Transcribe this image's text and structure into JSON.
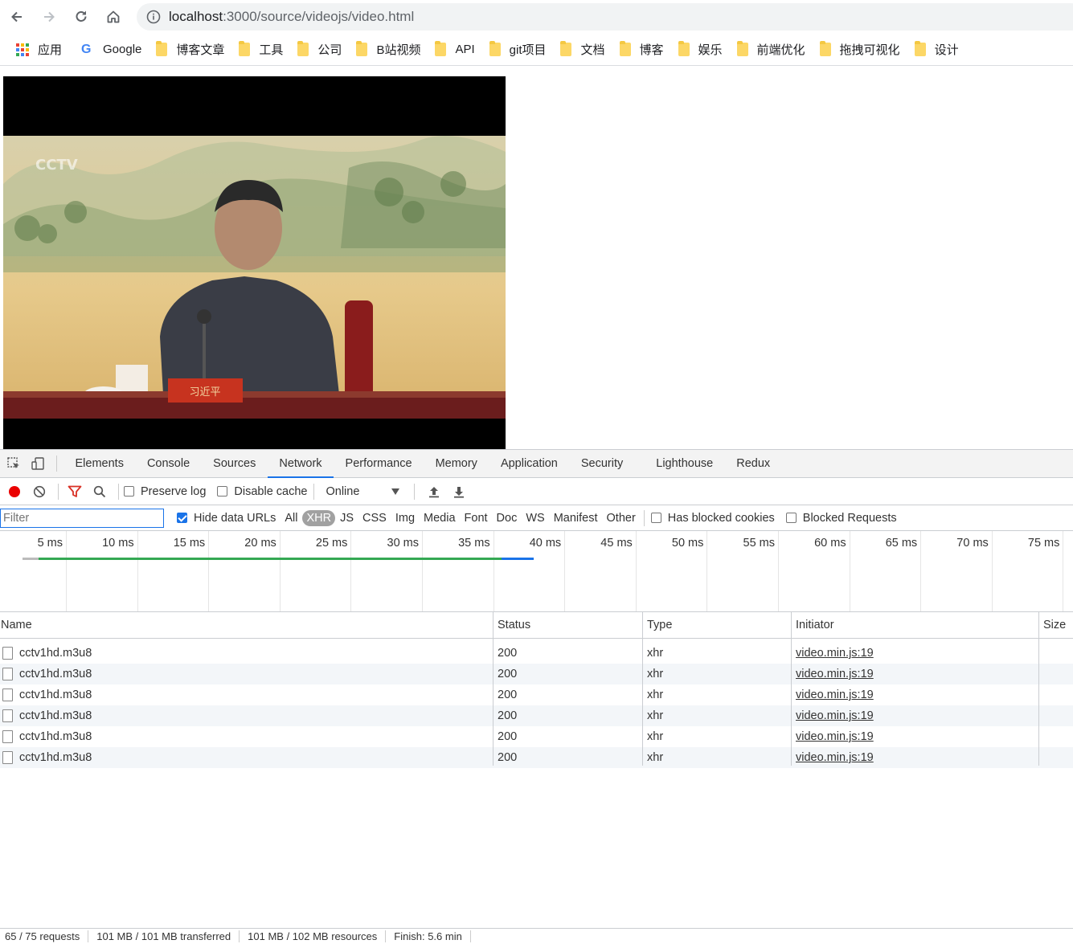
{
  "browser": {
    "url_host": "localhost",
    "url_rest": ":3000/source/videojs/video.html",
    "bookmarks": [
      {
        "label": "应用",
        "icon": "apps-grid-icon"
      },
      {
        "label": "Google",
        "icon": "google-icon"
      },
      {
        "label": "博客文章",
        "icon": "folder-icon"
      },
      {
        "label": "工具",
        "icon": "folder-icon"
      },
      {
        "label": "公司",
        "icon": "folder-icon"
      },
      {
        "label": "B站视频",
        "icon": "folder-icon"
      },
      {
        "label": "API",
        "icon": "folder-icon"
      },
      {
        "label": "git项目",
        "icon": "folder-icon"
      },
      {
        "label": "文档",
        "icon": "folder-icon"
      },
      {
        "label": "博客",
        "icon": "folder-icon"
      },
      {
        "label": "娱乐",
        "icon": "folder-icon"
      },
      {
        "label": "前端优化",
        "icon": "folder-icon"
      },
      {
        "label": "拖拽可视化",
        "icon": "folder-icon"
      },
      {
        "label": "设计",
        "icon": "folder-icon"
      }
    ]
  },
  "video": {
    "nameplate": "习近平"
  },
  "devtools": {
    "tabs": [
      "Elements",
      "Console",
      "Sources",
      "Network",
      "Performance",
      "Memory",
      "Application",
      "Security",
      "Lighthouse",
      "Redux"
    ],
    "active_tab": "Network",
    "controls": {
      "preserve_log": "Preserve log",
      "disable_cache": "Disable cache",
      "throttling": "Online"
    },
    "filter": {
      "placeholder": "Filter",
      "hide_data_urls": "Hide data URLs",
      "types": [
        "All",
        "XHR",
        "JS",
        "CSS",
        "Img",
        "Media",
        "Font",
        "Doc",
        "WS",
        "Manifest",
        "Other"
      ],
      "active_type": "XHR",
      "has_blocked_cookies": "Has blocked cookies",
      "blocked_requests": "Blocked Requests"
    },
    "timeline_ticks": [
      "5 ms",
      "10 ms",
      "15 ms",
      "20 ms",
      "25 ms",
      "30 ms",
      "35 ms",
      "40 ms",
      "45 ms",
      "50 ms",
      "55 ms",
      "60 ms",
      "65 ms",
      "70 ms",
      "75 ms"
    ],
    "columns": [
      "Name",
      "Status",
      "Type",
      "Initiator",
      "Size"
    ],
    "rows": [
      {
        "name": "cctv1hd.m3u8",
        "status": "200",
        "type": "xhr",
        "initiator": "video.min.js:19"
      },
      {
        "name": "cctv1hd.m3u8",
        "status": "200",
        "type": "xhr",
        "initiator": "video.min.js:19"
      },
      {
        "name": "cctv1hd.m3u8",
        "status": "200",
        "type": "xhr",
        "initiator": "video.min.js:19"
      },
      {
        "name": "cctv1hd.m3u8",
        "status": "200",
        "type": "xhr",
        "initiator": "video.min.js:19"
      },
      {
        "name": "cctv1hd.m3u8",
        "status": "200",
        "type": "xhr",
        "initiator": "video.min.js:19"
      },
      {
        "name": "cctv1hd.m3u8",
        "status": "200",
        "type": "xhr",
        "initiator": "video.min.js:19"
      }
    ],
    "status_bar": [
      "65 / 75 requests",
      "101 MB / 101 MB transferred",
      "101 MB / 102 MB resources",
      "Finish: 5.6 min"
    ]
  },
  "colors": {
    "accent": "#1a73e8",
    "record": "#ea0000",
    "filter_icon": "#d93025",
    "timeline_green": "#34a853",
    "timeline_blue": "#1a73e8"
  }
}
